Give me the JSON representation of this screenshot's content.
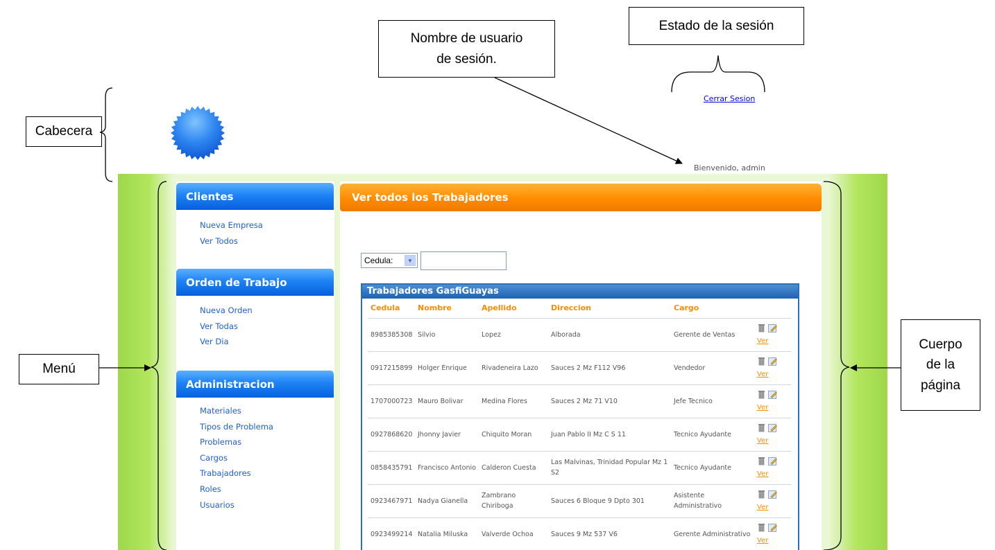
{
  "annotations": {
    "header": "Cabecera",
    "menu": "Menú",
    "username": [
      "Nombre de usuario",
      "de sesión."
    ],
    "session_state": "Estado de la sesión",
    "body": [
      "Cuerpo",
      "de la",
      "página"
    ]
  },
  "header": {
    "logout_link": "Cerrar Sesion",
    "welcome": "Bienvenido, admin"
  },
  "menu": {
    "clients": {
      "title": "Clientes",
      "items": [
        "Nueva Empresa",
        "Ver Todos"
      ]
    },
    "orders": {
      "title": "Orden de Trabajo",
      "items": [
        "Nueva Orden",
        "Ver Todas",
        "Ver Dia"
      ]
    },
    "admin": {
      "title": "Administracion",
      "items": [
        "Materiales",
        "Tipos de Problema",
        "Problemas",
        "Cargos",
        "Trabajadores",
        "Roles",
        "Usuarios"
      ]
    }
  },
  "content": {
    "title": "Ver todos los Trabajadores",
    "filter": {
      "selected": "Cedula:",
      "value": ""
    },
    "grid": {
      "title": "Trabajadores GasfiGuayas",
      "columns": [
        "Cedula",
        "Nombre",
        "Apellido",
        "Direccion",
        "Cargo"
      ],
      "view_label": "Ver",
      "rows": [
        [
          "8985385308",
          "Silvio",
          "Lopez",
          "Alborada",
          "Gerente de Ventas"
        ],
        [
          "0917215899",
          "Holger Enrique",
          "Rivadeneira Lazo",
          "Sauces 2 Mz F112 V96",
          "Vendedor"
        ],
        [
          "1707000723",
          "Mauro Bolivar",
          "Medina Flores",
          "Sauces 2 Mz 71 V10",
          "Jefe Tecnico"
        ],
        [
          "0927868620",
          "Jhonny Javier",
          "Chiquito Moran",
          "Juan Pablo II Mz C S 11",
          "Tecnico Ayudante"
        ],
        [
          "0858435791",
          "Francisco Antonio",
          "Calderon Cuesta",
          "Las Malvinas, Trinidad Popular Mz 1 S2",
          "Tecnico Ayudante"
        ],
        [
          "0923467971",
          "Nadya Gianella",
          "Zambrano Chiriboga",
          "Sauces 6 Bloque 9 Dpto 301",
          "Asistente Administrativo"
        ],
        [
          "0923499214",
          "Natalia Miluska",
          "Valverde Ochoa",
          "Sauces 9 Mz 537 V6",
          "Gerente Administrativo"
        ]
      ]
    }
  },
  "colors": {
    "accent_orange": "#ff8c00",
    "menu_blue": "#0660dd",
    "frame_green": "#9ed84a",
    "grid_blue": "#2d6fb5"
  },
  "icons": [
    "starburst-logo",
    "trash-icon",
    "edit-icon",
    "chevron-down-icon"
  ]
}
